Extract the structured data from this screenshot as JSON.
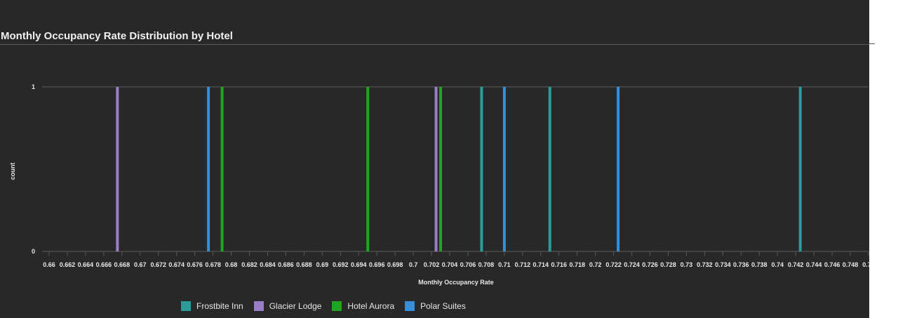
{
  "chart_data": {
    "type": "bar",
    "title": "Monthly Occupancy Rate Distribution by Hotel",
    "xlabel": "Monthly Occupancy Rate",
    "ylabel": "count",
    "xlim": [
      0.66,
      0.75
    ],
    "ylim": [
      0,
      1
    ],
    "x_tick_step": 0.002,
    "y_ticks": [
      0,
      1
    ],
    "grid": true,
    "legend_position": "bottom",
    "series": [
      {
        "name": "Frostbite Inn",
        "color": "#2a9d9a",
        "x": [
          0.7075,
          0.715,
          0.7425
        ],
        "values": [
          1,
          1,
          1
        ]
      },
      {
        "name": "Glacier Lodge",
        "color": "#9a7dc8",
        "x": [
          0.6675,
          0.7025
        ],
        "values": [
          1,
          1
        ]
      },
      {
        "name": "Hotel Aurora",
        "color": "#22a322",
        "x": [
          0.679,
          0.695,
          0.703
        ],
        "values": [
          1,
          1,
          1
        ]
      },
      {
        "name": "Polar Suites",
        "color": "#3490dc",
        "x": [
          0.6775,
          0.71,
          0.7225
        ],
        "values": [
          1,
          1,
          1
        ]
      }
    ]
  }
}
